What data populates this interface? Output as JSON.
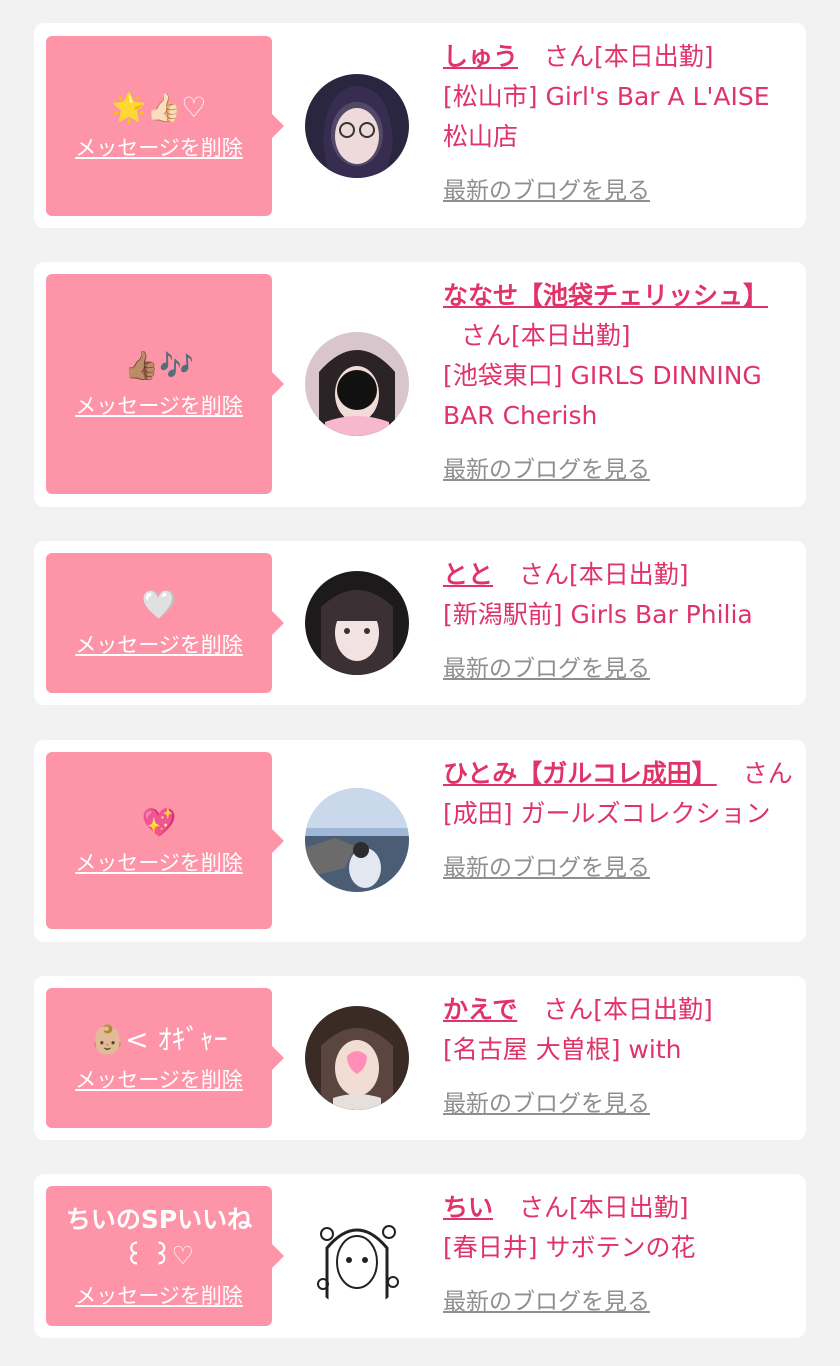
{
  "colors": {
    "background": "#f2f2f2",
    "card": "#ffffff",
    "bubble": "#fd94a7",
    "accent": "#e0336a",
    "link_gray": "#8f8f8f"
  },
  "entries": [
    {
      "message": "🌟👍🏻♡",
      "delete_label": "メッセージを削除",
      "name": "しゅう",
      "suffix": "さん[本日出勤]",
      "shop": "[松山市] Girl's Bar A L'AISE 松山店",
      "blog_label": "最新のブログを見る",
      "avatar_icon": "avatar-photo"
    },
    {
      "message": "👍🏽🎶",
      "delete_label": "メッセージを削除",
      "name": "ななせ【池袋チェリッシュ】",
      "suffix": "さん[本日出勤]",
      "shop": "[池袋東口] GIRLS DINNING BAR Cherish",
      "blog_label": "最新のブログを見る",
      "avatar_icon": "avatar-photo"
    },
    {
      "message": "🤍",
      "delete_label": "メッセージを削除",
      "name": "とと",
      "suffix": "さん[本日出勤]",
      "shop": "[新潟駅前] Girls Bar Philia",
      "blog_label": "最新のブログを見る",
      "avatar_icon": "avatar-photo"
    },
    {
      "message": "💖",
      "delete_label": "メッセージを削除",
      "name": "ひとみ【ガルコレ成田】",
      "suffix": "さん",
      "shop": "[成田] ガールズコレクション",
      "blog_label": "最新のブログを見る",
      "avatar_icon": "avatar-photo"
    },
    {
      "message": "👶🏼< ｵｷﾞｬｰ",
      "delete_label": "メッセージを削除",
      "name": "かえで",
      "suffix": "さん[本日出勤]",
      "shop": "[名古屋 大曽根] with",
      "blog_label": "最新のブログを見る",
      "avatar_icon": "avatar-photo"
    },
    {
      "message": "ちいのSPいいね ꒰ ꒱♡",
      "delete_label": "メッセージを削除",
      "name": "ちい",
      "suffix": "さん[本日出勤]",
      "shop": "[春日井] サボテンの花",
      "blog_label": "最新のブログを見る",
      "avatar_icon": "avatar-illustration"
    }
  ]
}
